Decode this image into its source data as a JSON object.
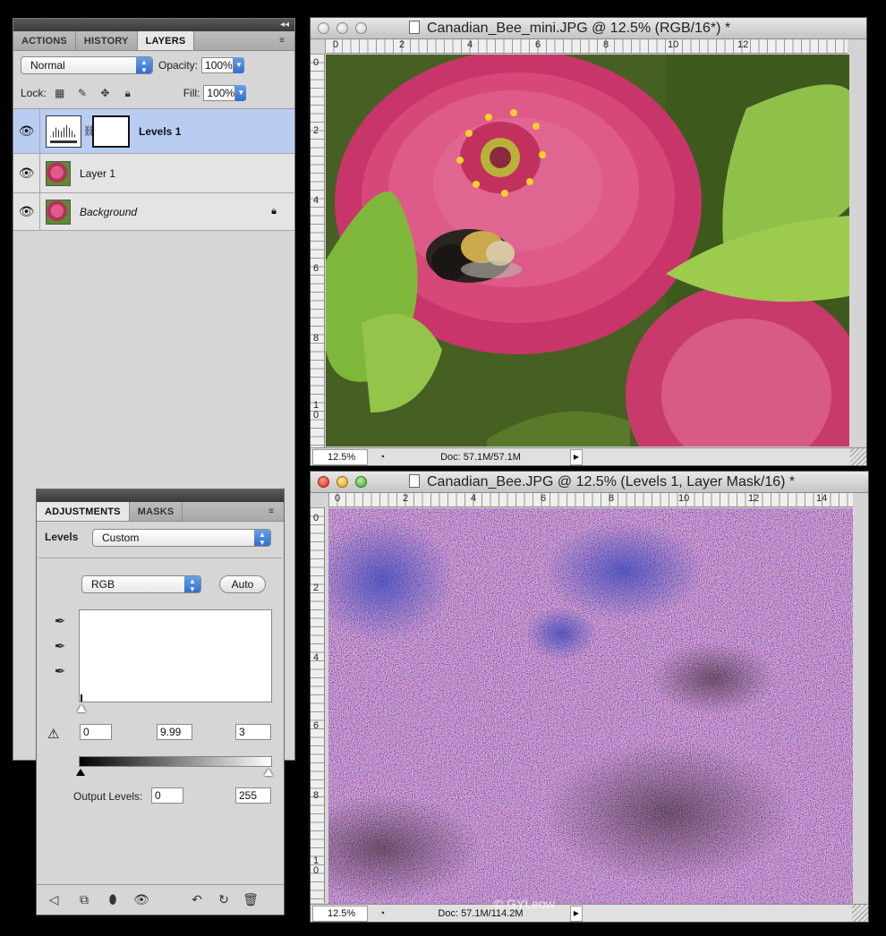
{
  "layers_panel": {
    "tabs": [
      "ACTIONS",
      "HISTORY",
      "LAYERS"
    ],
    "blend_mode": "Normal",
    "opacity_label": "Opacity:",
    "opacity_value": "100%",
    "lock_label": "Lock:",
    "fill_label": "Fill:",
    "fill_value": "100%",
    "layers": [
      {
        "name": "Levels 1",
        "selected": true
      },
      {
        "name": "Layer 1",
        "selected": false
      },
      {
        "name": "Background",
        "selected": false,
        "locked": true
      }
    ]
  },
  "adjustments_panel": {
    "tabs": [
      "ADJUSTMENTS",
      "MASKS"
    ],
    "type_label": "Levels",
    "preset_value": "Custom",
    "channel_value": "RGB",
    "auto_button": "Auto",
    "input_black": "0",
    "input_gamma": "9.99",
    "input_white": "3",
    "output_label": "Output Levels:",
    "output_black": "0",
    "output_white": "255"
  },
  "doc1": {
    "title": "Canadian_Bee_mini.JPG @ 12.5% (RGB/16*) *",
    "zoom": "12.5%",
    "doc_info": "Doc: 57.1M/57.1M",
    "ruler_h": [
      "0",
      "2",
      "4",
      "6",
      "8",
      "10",
      "12"
    ],
    "ruler_v": [
      "0",
      "2",
      "4",
      "6",
      "8",
      "1\n0"
    ]
  },
  "doc2": {
    "title": "Canadian_Bee.JPG @ 12.5% (Levels 1, Layer Mask/16) *",
    "zoom": "12.5%",
    "doc_info": "Doc: 57.1M/114.2M",
    "ruler_h": [
      "0",
      "2",
      "4",
      "6",
      "8",
      "10",
      "12",
      "14"
    ],
    "ruler_v": [
      "0",
      "2",
      "4",
      "6",
      "8",
      "1\n0"
    ]
  },
  "watermark": "© GYLeow",
  "colors": {
    "selected_layer": "#b9cdf3",
    "panel_bg": "#d6d6d6",
    "accent_blue": "#2f6fd0"
  }
}
